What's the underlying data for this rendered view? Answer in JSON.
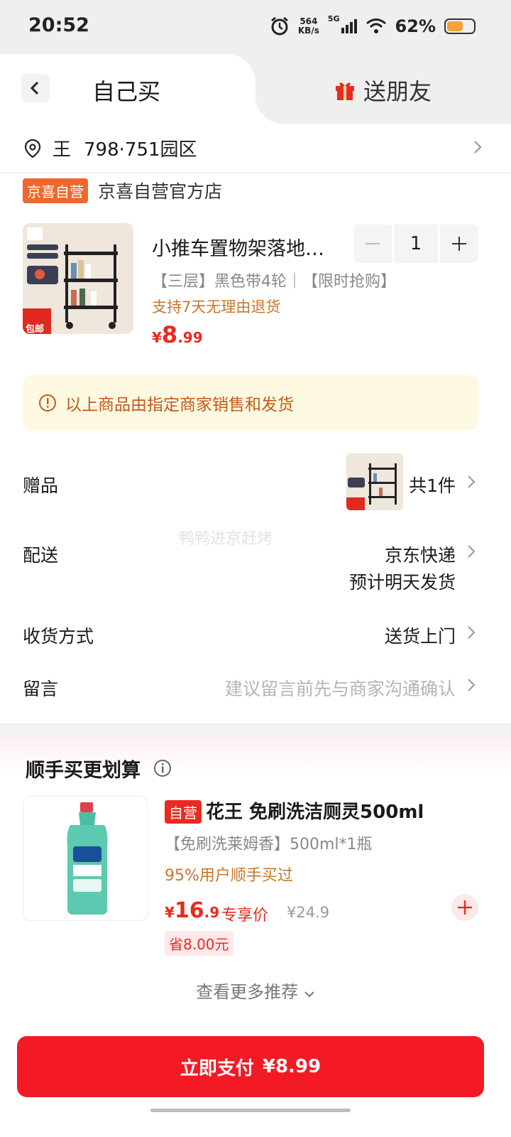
{
  "status": {
    "time": "20:52",
    "net_speed": "564",
    "net_unit": "KB/s",
    "network": "5G",
    "battery": "62%"
  },
  "tabs": {
    "self_buy": "自己买",
    "send_friend": "送朋友"
  },
  "address": {
    "name": "王",
    "detail": "798·751园区"
  },
  "shop": {
    "badge": "京喜自营",
    "name": "京喜自营官方店"
  },
  "product": {
    "title": "小推车置物架落地…",
    "spec": "【三层】黑色带4轮｜【限时抢购】",
    "return_policy": "支持7天无理由退货",
    "price_symbol": "¥",
    "price_int": "8",
    "price_dec": ".99",
    "quantity": "1",
    "thumb_label": "包邮"
  },
  "notice": {
    "text": "以上商品由指定商家销售和发货"
  },
  "rows": {
    "gift_label": "赠品",
    "gift_value": "共1件",
    "delivery_label": "配送",
    "delivery_value": "京东快递",
    "delivery_eta": "预计明天发货",
    "receive_label": "收货方式",
    "receive_value": "送货上门",
    "message_label": "留言",
    "message_placeholder": "建议留言前先与商家沟通确认"
  },
  "watermark": "鸭鸭进京赶烤",
  "recommend": {
    "title": "顺手买更划算",
    "badge": "自营",
    "name": "花王 免刷洗洁厕灵500ml",
    "spec": "【免刷洗莱姆香】500ml*1瓶",
    "social": "95%用户顺手买过",
    "price_symbol": "¥",
    "price_int": "16",
    "price_dec": ".9",
    "price_tag": "专享价",
    "orig_price": "¥24.9",
    "save": "省8.00元",
    "more": "查看更多推荐"
  },
  "pay": {
    "label": "立即支付",
    "amount": "¥8.99"
  },
  "colors": {
    "accent_red": "#f31a26",
    "price_red": "#ea2a20",
    "shop_orange": "#f0662e",
    "notice_bg": "#fef9e1"
  }
}
